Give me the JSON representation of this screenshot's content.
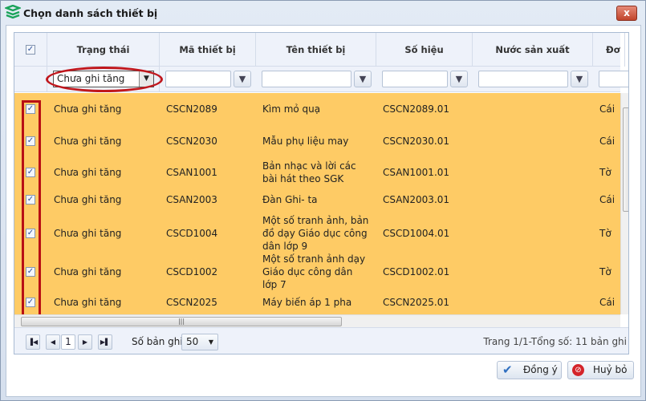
{
  "window": {
    "title": "Chọn danh sách thiết bị",
    "close_label": "x"
  },
  "grid": {
    "columns": [
      "Trạng thái",
      "Mã thiết bị",
      "Tên thiết bị",
      "Số hiệu",
      "Nước sản xuất",
      "Đơ"
    ],
    "filter": {
      "status_value": "Chưa ghi tăng"
    },
    "rows": [
      {
        "checked": true,
        "status": "Chưa ghi tăng",
        "code": "CSCN2089",
        "name": "Kìm mỏ quạ",
        "serial": "CSCN2089.01",
        "country": "",
        "unit": "Cái"
      },
      {
        "checked": true,
        "status": "Chưa ghi tăng",
        "code": "CSCN2030",
        "name": "Mẫu phụ liệu may",
        "serial": "CSCN2030.01",
        "country": "",
        "unit": "Cái"
      },
      {
        "checked": true,
        "status": "Chưa ghi tăng",
        "code": "CSAN1001",
        "name": "Bản nhạc và lời các bài hát theo SGK",
        "serial": "CSAN1001.01",
        "country": "",
        "unit": "Tờ"
      },
      {
        "checked": true,
        "status": "Chưa ghi tăng",
        "code": "CSAN2003",
        "name": "Đàn Ghi- ta",
        "serial": "CSAN2003.01",
        "country": "",
        "unit": "Cái"
      },
      {
        "checked": true,
        "status": "Chưa ghi tăng",
        "code": "CSCD1004",
        "name": "Một số tranh ảnh, bản đồ dạy Giáo dục công dân lớp 9",
        "serial": "CSCD1004.01",
        "country": "",
        "unit": "Tờ"
      },
      {
        "checked": true,
        "status": "Chưa ghi tăng",
        "code": "CSCD1002",
        "name": "Một số tranh ảnh dạy Giáo dục công dân lớp 7",
        "serial": "CSCD1002.01",
        "country": "",
        "unit": "Tờ"
      },
      {
        "checked": true,
        "status": "Chưa ghi tăng",
        "code": "CSCN2025",
        "name": "Máy biến áp 1 pha",
        "serial": "CSCN2025.01",
        "country": "",
        "unit": "Cái"
      }
    ]
  },
  "pager": {
    "page": "1",
    "records_label": "Số bản ghi:",
    "page_size": "50",
    "summary": "Trang 1/1-Tổng số: 11 bản ghi"
  },
  "buttons": {
    "ok": "Đồng ý",
    "cancel": "Huỷ bỏ"
  },
  "colors": {
    "row_highlight": "#fecb65",
    "annotation": "#c0171d"
  }
}
